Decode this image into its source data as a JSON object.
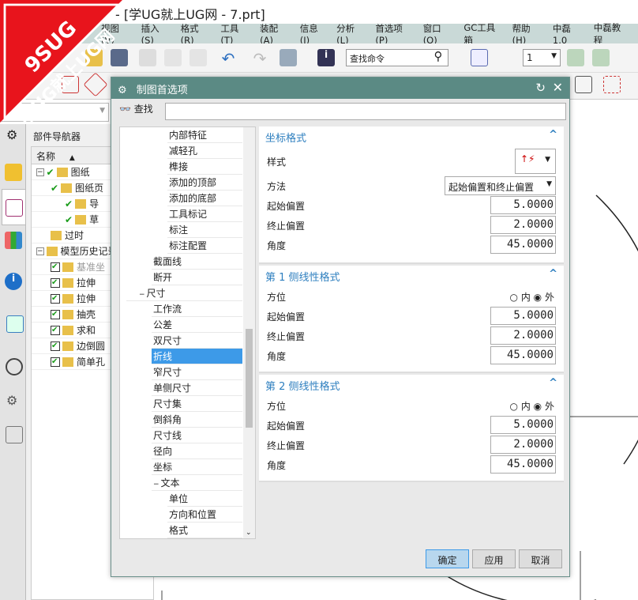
{
  "window": {
    "title": "- [学UG就上UG网 - 7.prt]"
  },
  "watermark": {
    "line1": "9SUG",
    "line2": "学UG就上UG网"
  },
  "menu": [
    "视图(V)",
    "插入(S)",
    "格式(R)",
    "工具(T)",
    "装配(A)",
    "信息(I)",
    "分析(L)",
    "首选项(P)",
    "窗口(O)",
    "GC工具箱",
    "帮助(H)",
    "中磊1.0",
    "中磊教程"
  ],
  "toolbar": {
    "search_placeholder": "查找命令",
    "layer_value": "1"
  },
  "navigator": {
    "title": "部件导航器",
    "column": "名称",
    "items": [
      {
        "label": "图纸",
        "level": 0
      },
      {
        "label": "图纸页",
        "level": 1
      },
      {
        "label": "导",
        "level": 2
      },
      {
        "label": "草",
        "level": 2
      },
      {
        "label": "过时",
        "level": 1
      },
      {
        "label": "模型历史记录",
        "level": 0
      },
      {
        "label": "基准坐",
        "level": 1
      },
      {
        "label": "拉伸",
        "level": 1
      },
      {
        "label": "拉伸",
        "level": 1
      },
      {
        "label": "抽壳",
        "level": 1
      },
      {
        "label": "求和",
        "level": 1
      },
      {
        "label": "边倒圆",
        "level": 1
      },
      {
        "label": "简单孔",
        "level": 1
      }
    ]
  },
  "dialog": {
    "title": "制图首选项",
    "find_label": "查找",
    "find_value": "",
    "tree": [
      {
        "label": "内部特征",
        "level": 3
      },
      {
        "label": "减轻孔",
        "level": 3
      },
      {
        "label": "榫接",
        "level": 3
      },
      {
        "label": "添加的顶部",
        "level": 3
      },
      {
        "label": "添加的底部",
        "level": 3
      },
      {
        "label": "工具标记",
        "level": 3
      },
      {
        "label": "标注",
        "level": 3
      },
      {
        "label": "标注配置",
        "level": 3
      },
      {
        "label": "截面线",
        "level": 2
      },
      {
        "label": "断开",
        "level": 2
      },
      {
        "label": "尺寸",
        "level": 1
      },
      {
        "label": "工作流",
        "level": 2
      },
      {
        "label": "公差",
        "level": 2
      },
      {
        "label": "双尺寸",
        "level": 2
      },
      {
        "label": "折线",
        "level": 2,
        "selected": true
      },
      {
        "label": "窄尺寸",
        "level": 2
      },
      {
        "label": "单侧尺寸",
        "level": 2
      },
      {
        "label": "尺寸集",
        "level": 2
      },
      {
        "label": "倒斜角",
        "level": 2
      },
      {
        "label": "尺寸线",
        "level": 2
      },
      {
        "label": "径向",
        "level": 2
      },
      {
        "label": "坐标",
        "level": 2
      },
      {
        "label": "文本",
        "level": 2
      },
      {
        "label": "单位",
        "level": 3
      },
      {
        "label": "方向和位置",
        "level": 3
      },
      {
        "label": "格式",
        "level": 3
      }
    ],
    "coord": {
      "title": "坐标格式",
      "style_label": "样式",
      "method_label": "方法",
      "method_value": "起始偏置和终止偏置",
      "start_label": "起始偏置",
      "start_value": "5.0000",
      "end_label": "终止偏置",
      "end_value": "2.0000",
      "angle_label": "角度",
      "angle_value": "45.0000"
    },
    "ext1": {
      "title": "第 1 侧线性格式",
      "side_label": "方位",
      "opt_in": "内",
      "opt_out": "外",
      "selected": "外",
      "start_label": "起始偏置",
      "start_value": "5.0000",
      "end_label": "终止偏置",
      "end_value": "2.0000",
      "angle_label": "角度",
      "angle_value": "45.0000"
    },
    "ext2": {
      "title": "第 2 侧线性格式",
      "side_label": "方位",
      "opt_in": "内",
      "opt_out": "外",
      "selected": "外",
      "start_label": "起始偏置",
      "start_value": "5.0000",
      "end_label": "终止偏置",
      "end_value": "2.0000",
      "angle_label": "角度",
      "angle_value": "45.0000"
    },
    "buttons": {
      "ok": "确定",
      "apply": "应用",
      "cancel": "取消"
    }
  },
  "colors": {
    "dialog_header": "#5b8a84",
    "accent": "#2e7fbf",
    "selection": "#3d9ae8"
  }
}
